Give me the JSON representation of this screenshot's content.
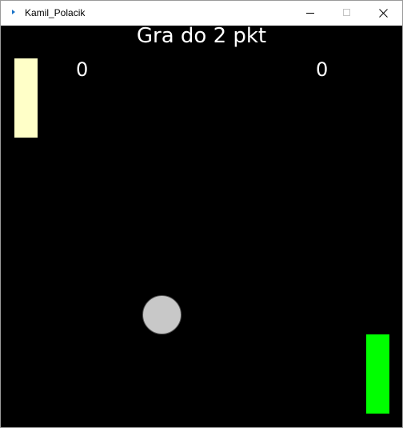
{
  "window": {
    "title": "Kamil_Polacik"
  },
  "game": {
    "title": "Gra do 2 pkt",
    "score_left": "0",
    "score_right": "0",
    "colors": {
      "background": "#000000",
      "paddle_left": "#ffffc8",
      "paddle_right": "#00ff00",
      "ball": "#c8c8c8",
      "text": "#ffffff"
    }
  }
}
